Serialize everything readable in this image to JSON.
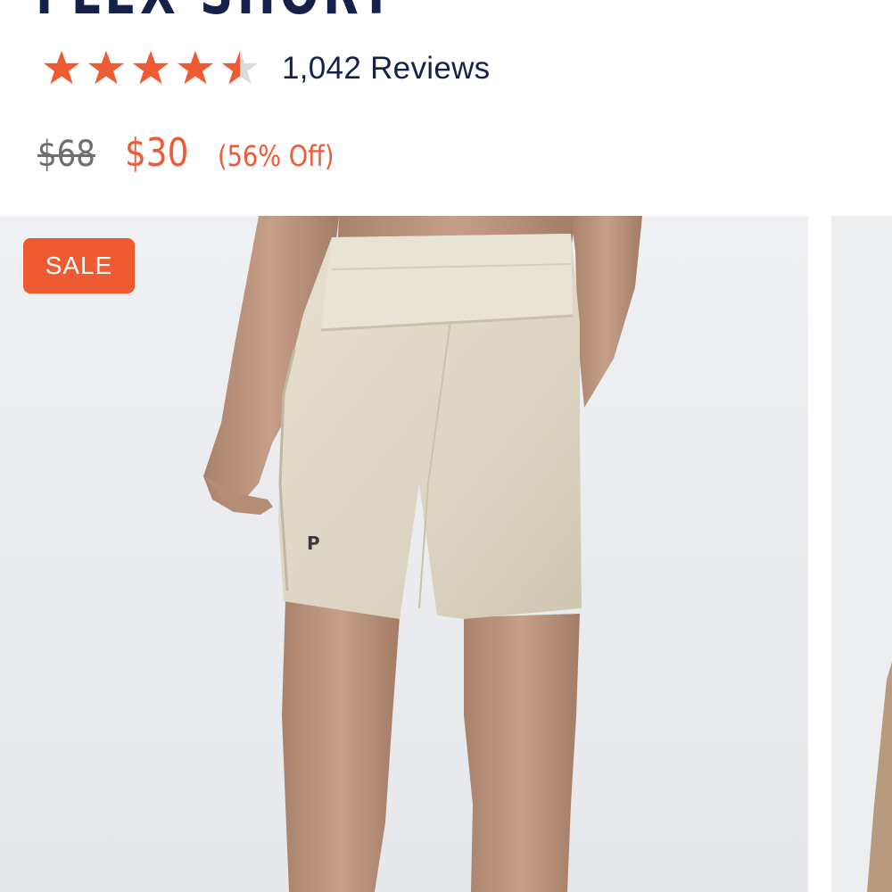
{
  "product": {
    "title": "FLEX SHORT",
    "rating": 4.5,
    "rating_max": 5,
    "reviews_label": "1,042 Reviews",
    "price_original": "$68",
    "price_sale": "$30",
    "discount_label": "(56% Off)"
  },
  "gallery": {
    "badge": "SALE"
  },
  "colors": {
    "accent": "#ee5a32",
    "navy": "#15214a",
    "star_empty": "#dcdcdc"
  },
  "icons": {
    "star": "star-icon",
    "half_star": "half-star-icon"
  }
}
